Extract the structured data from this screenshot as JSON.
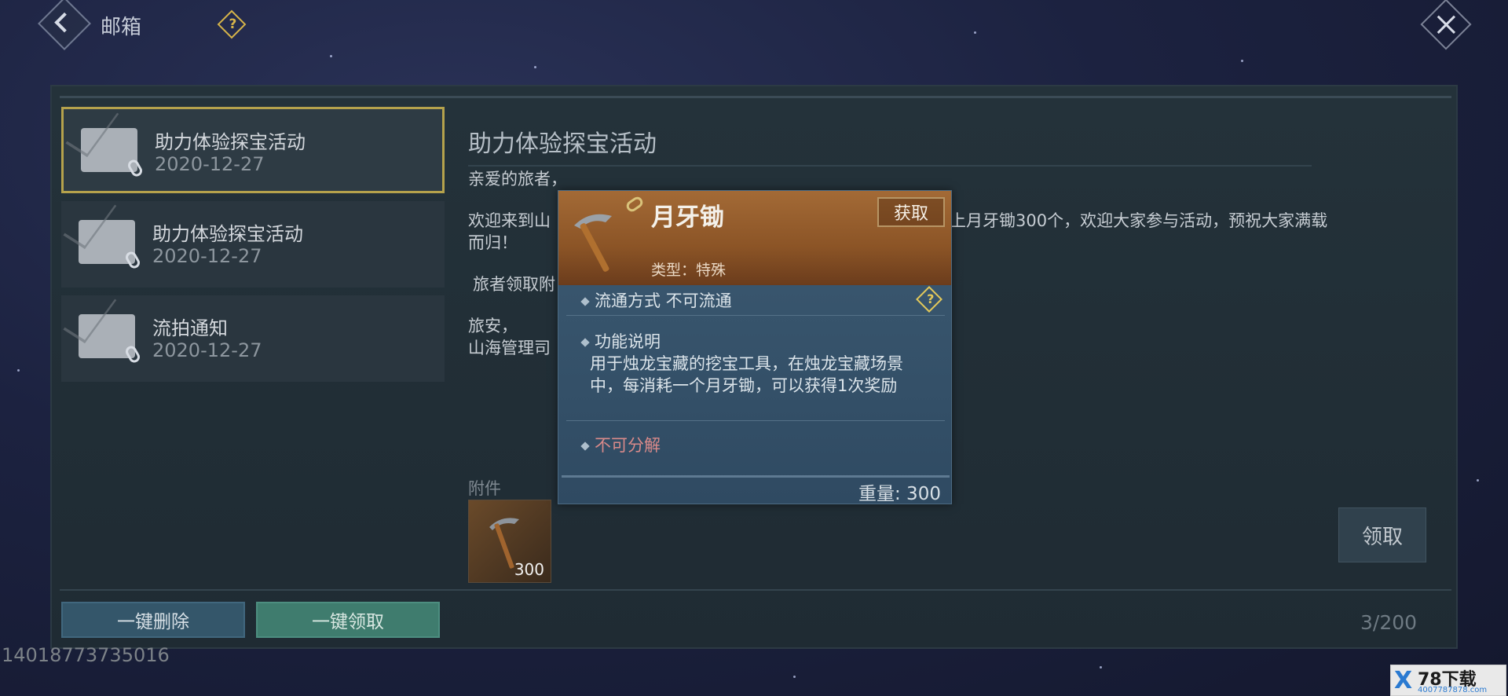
{
  "topbar": {
    "title": "邮箱",
    "help_symbol": "?"
  },
  "mail_list": [
    {
      "name": "助力体验探宝活动",
      "date": "2020-12-27",
      "selected": true
    },
    {
      "name": "助力体验探宝活动",
      "date": "2020-12-27",
      "selected": false
    },
    {
      "name": "流拍通知",
      "date": "2020-12-27",
      "selected": false
    }
  ],
  "mail": {
    "title": "助力体验探宝活动",
    "greeting": "亲爱的旅者，",
    "paragraph1_start": "欢迎来到山",
    "paragraph1_end": "理司特奉上月牙锄300个，欢迎大家参与活动，预祝大家满载",
    "paragraph1_wrap": "而归！",
    "paragraph2": "旅者领取附",
    "closing": "旅安，",
    "signature": "山海管理司"
  },
  "attachment": {
    "label": "附件",
    "count": "300"
  },
  "buttons": {
    "claim": "领取",
    "delete_all": "一键删除",
    "claim_all": "一键领取"
  },
  "mailbox_count": "3/200",
  "uid": "14018773735016",
  "tooltip": {
    "name": "月牙锄",
    "get_label": "获取",
    "type": "类型：特殊",
    "circulation": "流通方式   不可流通",
    "help_symbol": "?",
    "function_title": "功能说明",
    "function_body": "用于烛龙宝藏的挖宝工具，在烛龙宝藏场景中，每消耗一个月牙锄，可以获得1次奖励",
    "no_decompose": "不可分解",
    "weight": "重量: 300"
  },
  "watermark": {
    "mark": "X",
    "text": "78下载",
    "url": "4007787878.com"
  },
  "colors": {
    "selected_border": "#b5a24c",
    "tooltip_header": "#8b5426",
    "claim_all_bg": "#3f7c6e",
    "delete_bg": "#34566a",
    "warning_text": "#d98a8a"
  }
}
